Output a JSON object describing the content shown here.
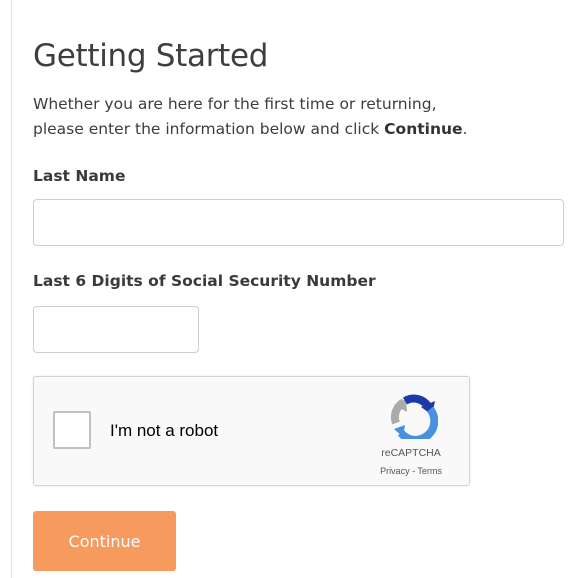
{
  "header": {
    "title": "Getting Started"
  },
  "intro": {
    "line1": "Whether you are here for the first time or returning,",
    "line2_prefix": "please enter the information below and click ",
    "line2_bold": "Continue",
    "line2_suffix": "."
  },
  "form": {
    "last_name": {
      "label": "Last Name",
      "value": "",
      "placeholder": ""
    },
    "ssn_last6": {
      "label": "Last 6 Digits of Social Security Number",
      "value": "",
      "placeholder": ""
    }
  },
  "captcha": {
    "label": "I'm not a robot",
    "brand": "reCAPTCHA",
    "privacy_label": "Privacy",
    "separator": " - ",
    "terms_label": "Terms",
    "checked": false,
    "logo_icon": "recaptcha-logo-icon"
  },
  "actions": {
    "continue_label": "Continue"
  },
  "colors": {
    "accent": "#f79a5e",
    "text": "#333333",
    "border": "#cfcfcf",
    "captcha_blue": "#1c3aa9",
    "captcha_lightblue": "#4a90e2",
    "captcha_gray": "#ababab"
  }
}
